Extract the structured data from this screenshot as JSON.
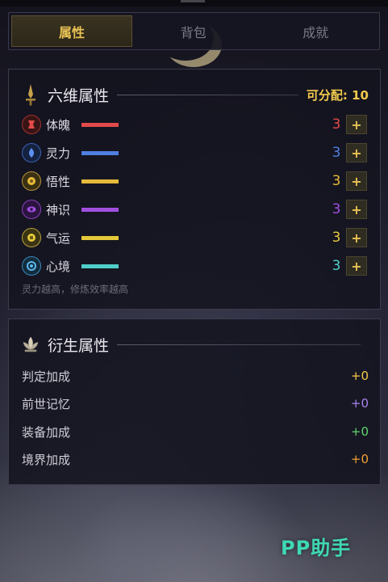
{
  "tabs": [
    {
      "label": "属性",
      "active": true
    },
    {
      "label": "背包",
      "active": false
    },
    {
      "label": "成就",
      "active": false
    }
  ],
  "primary": {
    "title": "六维属性",
    "allocatable_label": "可分配:",
    "allocatable_value": "10",
    "stats": [
      {
        "name": "体魄",
        "value": "3",
        "color": "#e24a4a",
        "icon": "body-icon"
      },
      {
        "name": "灵力",
        "value": "3",
        "color": "#4f7fe0",
        "icon": "spirit-icon"
      },
      {
        "name": "悟性",
        "value": "3",
        "color": "#e6b93a",
        "icon": "insight-icon"
      },
      {
        "name": "神识",
        "value": "3",
        "color": "#a24fe0",
        "icon": "sense-icon"
      },
      {
        "name": "气运",
        "value": "3",
        "color": "#e6c93a",
        "icon": "fortune-icon"
      },
      {
        "name": "心境",
        "value": "3",
        "color": "#4fcfc9",
        "icon": "mind-icon"
      }
    ],
    "plus_label": "+",
    "hint": "灵力越高，修炼效率越高"
  },
  "derived": {
    "title": "衍生属性",
    "items": [
      {
        "name": "判定加成",
        "value": "+0",
        "color": "#f2c94c"
      },
      {
        "name": "前世记忆",
        "value": "+0",
        "color": "#a884f0"
      },
      {
        "name": "装备加成",
        "value": "+0",
        "color": "#5fd66a"
      },
      {
        "name": "境界加成",
        "value": "+0",
        "color": "#f0a030"
      }
    ]
  },
  "watermark": "PP助手"
}
